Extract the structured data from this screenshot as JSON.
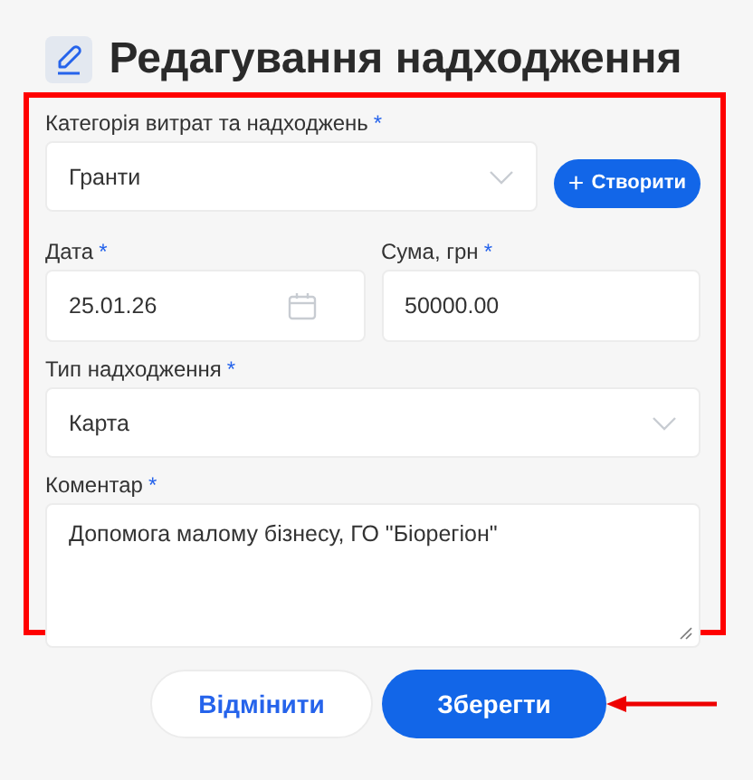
{
  "title": "Редагування надходження",
  "form": {
    "category": {
      "label": "Категорія витрат та надходжень",
      "required_mark": "*",
      "value": "Гранти"
    },
    "create_button": {
      "icon": "+",
      "label": "Створити"
    },
    "date": {
      "label": "Дата",
      "required_mark": "*",
      "value": "25.01.26"
    },
    "amount": {
      "label": "Сума, грн",
      "required_mark": "*",
      "value": "50000.00"
    },
    "income_type": {
      "label": "Тип надходження",
      "required_mark": "*",
      "value": "Карта"
    },
    "comment": {
      "label": "Коментар",
      "required_mark": "*",
      "value": "Допомога малому бізнесу, ГО \"Біорегіон\""
    }
  },
  "buttons": [
    {
      "kind": "secondary",
      "label": "Відмінити"
    },
    {
      "kind": "primary",
      "label": "Зберегти"
    }
  ]
}
